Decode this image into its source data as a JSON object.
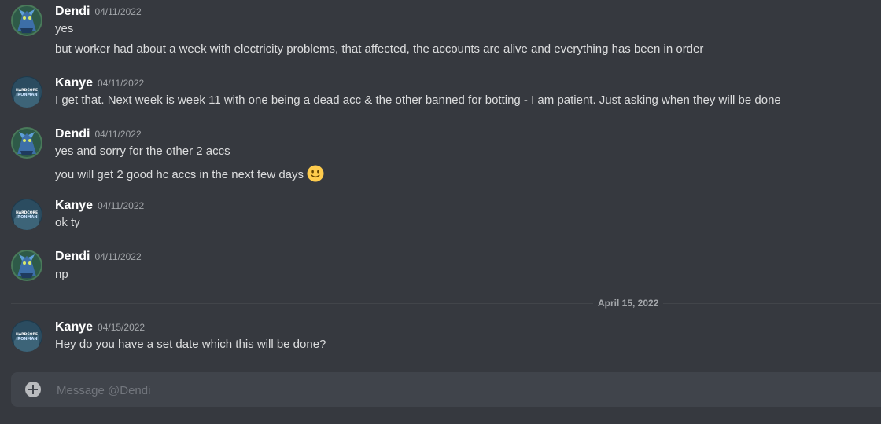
{
  "messages": [
    {
      "author": "Dendi",
      "timestamp": "04/11/2022",
      "avatar": "dendi-avatar",
      "lines": [
        "yes",
        "but  worker had about a week with electricity problems, that affected, the accounts are alive and everything has been in order"
      ]
    },
    {
      "author": "Kanye",
      "timestamp": "04/11/2022",
      "avatar": "hardcore-ironman-avatar",
      "lines": [
        "I get that. Next week is week 11 with one being a dead acc & the other banned for botting - I am patient. Just asking when they will be done"
      ]
    },
    {
      "author": "Dendi",
      "timestamp": "04/11/2022",
      "avatar": "dendi-avatar",
      "lines": [
        "yes and sorry for the other 2 accs",
        "you will get 2 good hc accs in the next few days"
      ],
      "emoji": "slightly-smiling-face"
    },
    {
      "author": "Kanye",
      "timestamp": "04/11/2022",
      "avatar": "hardcore-ironman-avatar",
      "lines": [
        "ok ty"
      ]
    },
    {
      "author": "Dendi",
      "timestamp": "04/11/2022",
      "avatar": "dendi-avatar",
      "lines": [
        "np"
      ]
    },
    {
      "author": "Kanye",
      "timestamp": "04/15/2022",
      "avatar": "hardcore-ironman-avatar",
      "lines": [
        "Hey do you have a set date which this will be done?"
      ]
    }
  ],
  "date_divider": "April 15, 2022",
  "avatar_badge": {
    "line1": "HARDCORE",
    "line2": "IRONMAN"
  },
  "composer": {
    "placeholder": "Message @Dendi",
    "value": ""
  },
  "colors": {
    "background": "#36393f",
    "composer": "#40444b",
    "text": "#dcddde",
    "muted": "#a3a6aa",
    "author": "#ffffff"
  }
}
